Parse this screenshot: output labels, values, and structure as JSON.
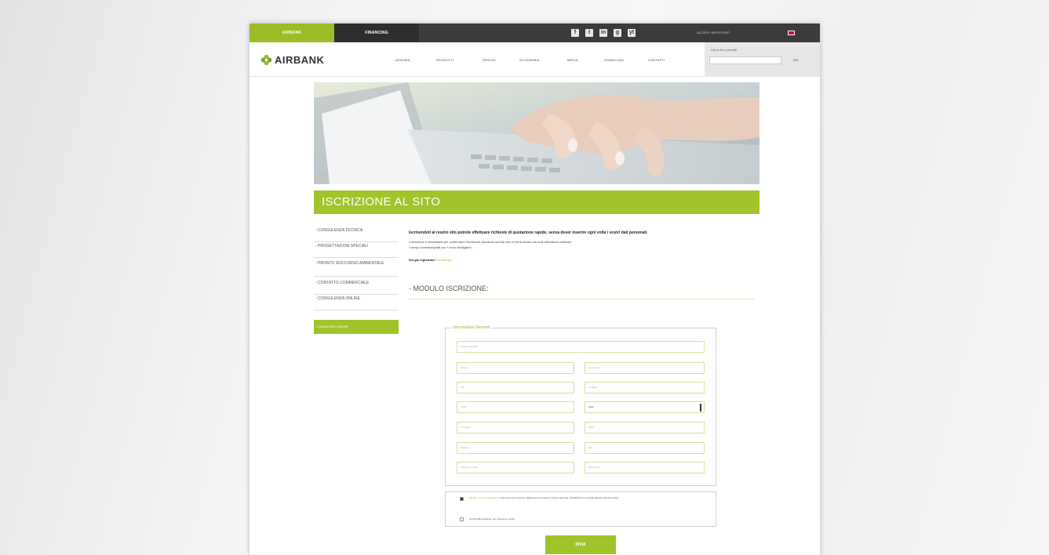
{
  "topbar": {
    "tab_active": "AIRBANK",
    "tab_second": "FINANCING",
    "login_text": "ACCEDI / REGISTRATI",
    "social": [
      "f",
      "t",
      "in",
      "g",
      "yt"
    ]
  },
  "header": {
    "logo": "AIRBANK",
    "nav": [
      "AZIENDA",
      "PRODOTTI",
      "SERVIZI",
      "ACCADEMIA",
      "MEDIA",
      "DOWNLOAD",
      "CONTATTI"
    ],
    "search_label": "Cerca tra i prodotti",
    "search_go": "GO"
  },
  "banner": {
    "title": "ISCRIZIONE AL SITO"
  },
  "sidebar": {
    "items": [
      "- CONSULENZA TECNICA",
      "- PROGETTAZIONI SPECIALI",
      "- PRONTO SOCCORSO AMBIENTALE",
      "- CONTATTO COMMERCIALE",
      "- CONSULENZA ONLINE"
    ],
    "button": "> CATALOGO ONLINE"
  },
  "main": {
    "intro_bold": "Iscrivendoti al nostro sito potrete effettuare richieste di quotazione rapide, senza dover inserire ogni volta i vostri dati personali.",
    "intro_line1": "L'iscrizione è necessaria per confermare l'iscrizione cliccando sul link che vi verrà inviato via mail all'indirizzo indicato.",
    "intro_line2": "I campi contrassegnati con * sono obbligatori.",
    "already_label": "Sei già registrato?",
    "already_link": "Accedi qui",
    "section_title": "- MODULO ISCRIZIONE:"
  },
  "form": {
    "legend": "Informazioni Generali",
    "full_row": "Ragione Sociale*",
    "rows": [
      [
        "Nome*",
        "Cognome*"
      ],
      [
        "Via*",
        "Località*"
      ],
      [
        "Città*",
        "Italia"
      ],
      [
        "Provincia*",
        "CAP*"
      ],
      [
        "Telefono",
        "Fax"
      ],
      [
        "Indirizzo e-mail*",
        "Password*"
      ]
    ],
    "consent_privacy_link": "Privacy - Accetto Informativa",
    "consent_privacy": "I dati personali verranno trattati secondo quanto previsto dal D.lgs. 196/2003 per le finalità indicate nell'informativa.",
    "consent_newsletter": "Iscriviti alla newsletter per ricevere le novità",
    "submit": "INVIA"
  }
}
